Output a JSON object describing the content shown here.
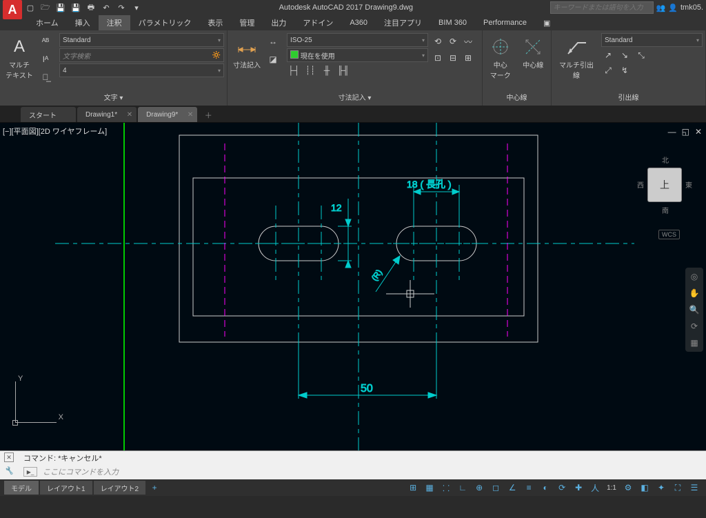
{
  "app": {
    "logo_letter": "A",
    "name": "Autodesk AutoCAD 2017",
    "document": "Drawing9.dwg"
  },
  "title_full": "Autodesk AutoCAD 2017   Drawing9.dwg",
  "search_placeholder": "キーワードまたは語句を入力",
  "user": {
    "name": "tmk05."
  },
  "ribbon_tabs": {
    "t0": "ホーム",
    "t1": "挿入",
    "t2": "注釈",
    "t3": "パラメトリック",
    "t4": "表示",
    "t5": "管理",
    "t6": "出力",
    "t7": "アドイン",
    "t8": "A360",
    "t9": "注目アプリ",
    "t10": "BIM 360",
    "t11": "Performance"
  },
  "panels": {
    "text": {
      "big_label": "マルチ\nテキスト",
      "style": "Standard",
      "search": "文字検索",
      "height": "4",
      "title": "文字 ▾"
    },
    "dim": {
      "big_label": "寸法記入",
      "style": "ISO-25",
      "layer": "現在を使用",
      "title": "寸法記入 ▾"
    },
    "center": {
      "b1": "中心\nマーク",
      "b2": "中心線",
      "title": "中心線"
    },
    "leader": {
      "big_label": "マルチ引出線",
      "style": "Standard",
      "title": "引出線"
    }
  },
  "file_tabs": {
    "t0": "スタート",
    "t1": "Drawing1*",
    "t2": "Drawing9*"
  },
  "viewport_label": "[−][平面図][2D ワイヤフレーム]",
  "viewcube": {
    "top": "上",
    "n": "北",
    "s": "南",
    "e": "東",
    "w": "西"
  },
  "wcs": "WCS",
  "ucs": {
    "x": "X",
    "y": "Y"
  },
  "dims": {
    "w": "50",
    "h": "12",
    "slot": "18 ( 長孔 )",
    "r": "(R)"
  },
  "cmd": {
    "recent": "コマンド: *キャンセル*",
    "placeholder": "ここにコマンドを入力",
    "prompt": "▶_"
  },
  "layout_tabs": {
    "model": "モデル",
    "l1": "レイアウト1",
    "l2": "レイアウト2"
  },
  "status": {
    "scale": "1:1"
  }
}
